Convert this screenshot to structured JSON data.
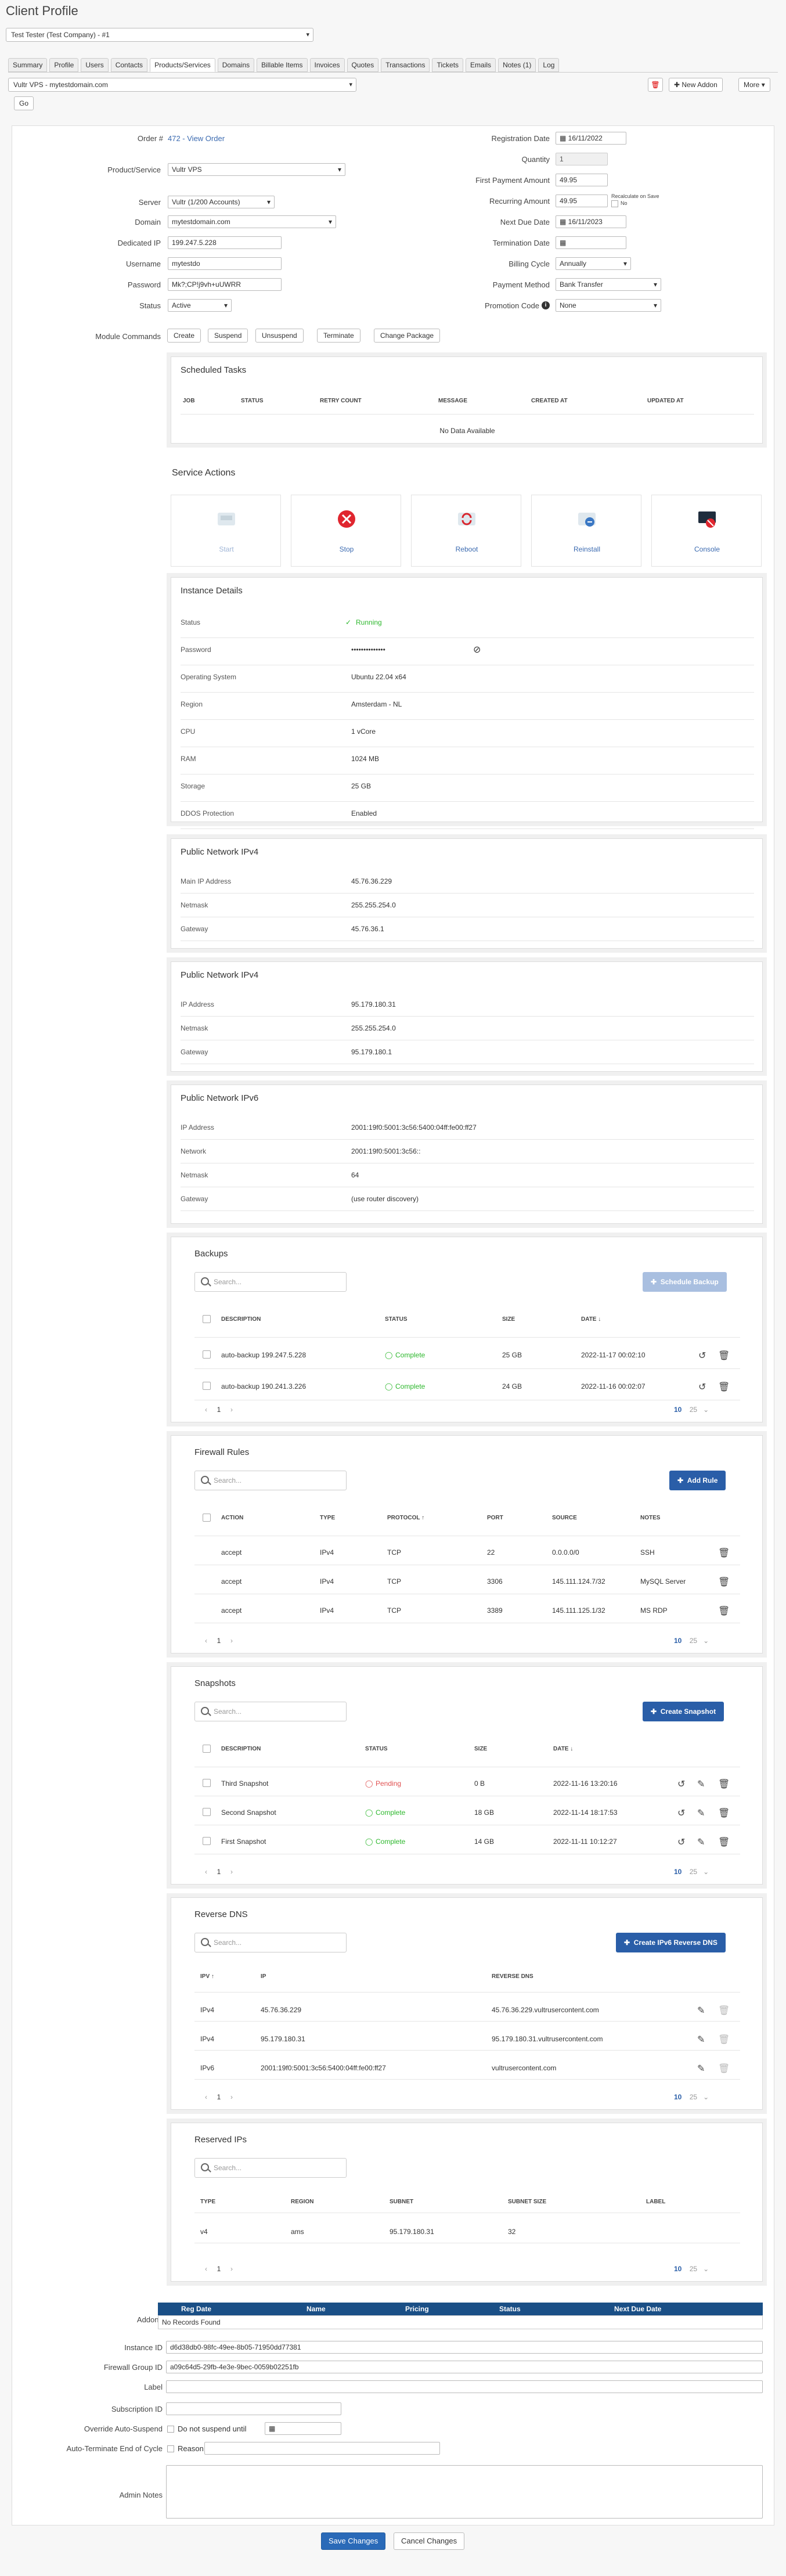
{
  "page": {
    "title": "Client Profile",
    "client_select": "Test Tester (Test Company) - #1"
  },
  "tabs": [
    "Summary",
    "Profile",
    "Users",
    "Contacts",
    "Products/Services",
    "Domains",
    "Billable Items",
    "Invoices",
    "Quotes",
    "Transactions",
    "Tickets",
    "Emails",
    "Notes (1)",
    "Log"
  ],
  "service_select": "Vultr VPS - mytestdomain.com",
  "buttons": {
    "go": "Go",
    "new_addon": "New Addon",
    "more": "More"
  },
  "left": {
    "order_label": "Order #",
    "order_value": "472 - View Order",
    "product_label": "Product/Service",
    "product_value": "Vultr VPS",
    "server_label": "Server",
    "server_value": "Vultr (1/200 Accounts)",
    "domain_label": "Domain",
    "domain_value": "mytestdomain.com",
    "ip_label": "Dedicated IP",
    "ip_value": "199.247.5.228",
    "user_label": "Username",
    "user_value": "mytestdo",
    "pass_label": "Password",
    "pass_value": "Mk?;CP!j9vh+uUWRR",
    "status_label": "Status",
    "status_value": "Active",
    "module_label": "Module Commands",
    "module_buttons": [
      "Create",
      "Suspend",
      "Unsuspend",
      "Terminate",
      "Change Package"
    ]
  },
  "right": {
    "reg_label": "Registration Date",
    "reg_value": "16/11/2022",
    "qty_label": "Quantity",
    "qty_value": "1",
    "first_label": "First Payment Amount",
    "first_value": "49.95",
    "rec_label": "Recurring Amount",
    "rec_value": "49.95",
    "recalc": "Recalculate on Save",
    "recalc2": "No",
    "next_label": "Next Due Date",
    "next_value": "16/11/2023",
    "term_label": "Termination Date",
    "term_value": "",
    "cycle_label": "Billing Cycle",
    "cycle_value": "Annually",
    "pay_label": "Payment Method",
    "pay_value": "Bank Transfer",
    "promo_label": "Promotion Code",
    "promo_value": "None"
  },
  "scheduled": {
    "title": "Scheduled Tasks",
    "cols": [
      "JOB",
      "STATUS",
      "RETRY COUNT",
      "MESSAGE",
      "CREATED AT",
      "UPDATED AT"
    ],
    "empty": "No Data Available"
  },
  "service_actions": {
    "title": "Service Actions",
    "items": [
      "Start",
      "Stop",
      "Reboot",
      "Reinstall",
      "Console"
    ]
  },
  "instance": {
    "title": "Instance Details",
    "rows": [
      [
        "Status",
        "Running"
      ],
      [
        "Password",
        "••••••••••••••"
      ],
      [
        "Operating System",
        "Ubuntu 22.04 x64"
      ],
      [
        "Region",
        "Amsterdam - NL"
      ],
      [
        "CPU",
        "1 vCore"
      ],
      [
        "RAM",
        "1024 MB"
      ],
      [
        "Storage",
        "25 GB"
      ],
      [
        "DDOS Protection",
        "Enabled"
      ]
    ]
  },
  "ipv4a": {
    "title": "Public Network IPv4",
    "rows": [
      [
        "Main IP Address",
        "45.76.36.229"
      ],
      [
        "Netmask",
        "255.255.254.0"
      ],
      [
        "Gateway",
        "45.76.36.1"
      ]
    ]
  },
  "ipv4b": {
    "title": "Public Network IPv4",
    "rows": [
      [
        "IP Address",
        "95.179.180.31"
      ],
      [
        "Netmask",
        "255.255.254.0"
      ],
      [
        "Gateway",
        "95.179.180.1"
      ]
    ]
  },
  "ipv6": {
    "title": "Public Network IPv6",
    "rows": [
      [
        "IP Address",
        "2001:19f0:5001:3c56:5400:04ff:fe00:ff27"
      ],
      [
        "Network",
        "2001:19f0:5001:3c56::"
      ],
      [
        "Netmask",
        "64"
      ],
      [
        "Gateway",
        "(use router discovery)"
      ]
    ]
  },
  "backups": {
    "title": "Backups",
    "search": "Search...",
    "button": "Schedule Backup",
    "cols": [
      "DESCRIPTION",
      "STATUS",
      "SIZE",
      "DATE"
    ],
    "rows": [
      [
        "auto-backup 199.247.5.228",
        "Complete",
        "25 GB",
        "2022-11-17 00:02:10"
      ],
      [
        "auto-backup 190.241.3.226",
        "Complete",
        "24 GB",
        "2022-11-16 00:02:07"
      ]
    ],
    "page": "1",
    "per_page": "10",
    "per_page2": "25"
  },
  "firewall": {
    "title": "Firewall Rules",
    "search": "Search...",
    "button": "Add Rule",
    "cols": [
      "ACTION",
      "TYPE",
      "PROTOCOL",
      "PORT",
      "SOURCE",
      "NOTES"
    ],
    "rows": [
      [
        "accept",
        "IPv4",
        "TCP",
        "22",
        "0.0.0.0/0",
        "SSH"
      ],
      [
        "accept",
        "IPv4",
        "TCP",
        "3306",
        "145.111.124.7/32",
        "MySQL Server"
      ],
      [
        "accept",
        "IPv4",
        "TCP",
        "3389",
        "145.111.125.1/32",
        "MS RDP"
      ]
    ],
    "page": "1",
    "per_page": "10",
    "per_page2": "25"
  },
  "snapshots": {
    "title": "Snapshots",
    "search": "Search...",
    "button": "Create Snapshot",
    "cols": [
      "DESCRIPTION",
      "STATUS",
      "SIZE",
      "DATE"
    ],
    "rows": [
      [
        "Third Snapshot",
        "Pending",
        "0 B",
        "2022-11-16 13:20:16"
      ],
      [
        "Second Snapshot",
        "Complete",
        "18 GB",
        "2022-11-14 18:17:53"
      ],
      [
        "First Snapshot",
        "Complete",
        "14 GB",
        "2022-11-11 10:12:27"
      ]
    ],
    "page": "1",
    "per_page": "10",
    "per_page2": "25"
  },
  "rdns": {
    "title": "Reverse DNS",
    "search": "Search...",
    "button": "Create IPv6 Reverse DNS",
    "cols": [
      "IPV",
      "IP",
      "REVERSE DNS"
    ],
    "rows": [
      [
        "IPv4",
        "45.76.36.229",
        "45.76.36.229.vultrusercontent.com"
      ],
      [
        "IPv4",
        "95.179.180.31",
        "95.179.180.31.vultrusercontent.com"
      ],
      [
        "IPv6",
        "2001:19f0:5001:3c56:5400:04ff:fe00:ff27",
        "vultrusercontent.com"
      ]
    ],
    "page": "1",
    "per_page": "10",
    "per_page2": "25"
  },
  "reserved": {
    "title": "Reserved IPs",
    "search": "Search...",
    "cols": [
      "TYPE",
      "REGION",
      "SUBNET",
      "SUBNET SIZE",
      "LABEL"
    ],
    "rows": [
      [
        "v4",
        "ams",
        "95.179.180.31",
        "32",
        ""
      ]
    ],
    "page": "1",
    "per_page": "10",
    "per_page2": "25"
  },
  "bottom": {
    "addons_label": "Addons",
    "addon_cols": [
      "Reg Date",
      "Name",
      "Pricing",
      "Status",
      "Next Due Date"
    ],
    "addon_empty": "No Records Found",
    "instance_label": "Instance ID",
    "instance_value": "d6d38db0-98fc-49ee-8b05-71950dd77381",
    "fwgroup_label": "Firewall Group ID",
    "fwgroup_value": "a09c64d5-29fb-4e3e-9bec-0059b02251fb",
    "label_label": "Label",
    "label_value": "",
    "sub_label": "Subscription ID",
    "sub_value": "",
    "override_label": "Override Auto-Suspend",
    "override_text": "Do not suspend until",
    "autoterm_label": "Auto-Terminate End of Cycle",
    "autoterm_text": "Reason",
    "notes_label": "Admin Notes"
  },
  "save": {
    "save": "Save Changes",
    "cancel": "Cancel Changes"
  },
  "colors": {
    "accent": "#2a5ea8",
    "success": "#2eb82e",
    "danger": "#e05050",
    "header": "#1a4f86"
  }
}
